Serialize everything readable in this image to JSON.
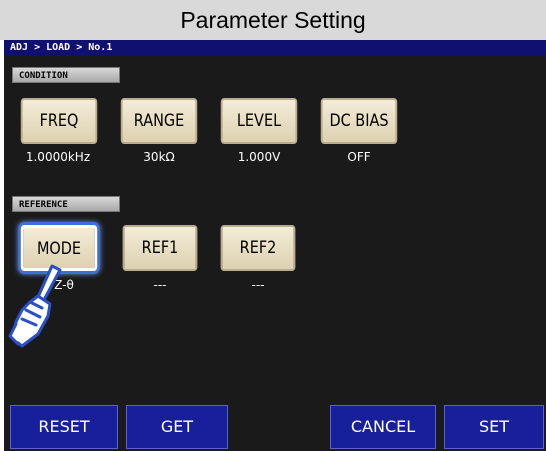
{
  "title": "Parameter Setting",
  "breadcrumb": "ADJ > LOAD > No.1",
  "condition": {
    "label": "CONDITION",
    "buttons": [
      {
        "label": "FREQ",
        "value": "1.0000kHz"
      },
      {
        "label": "RANGE",
        "value": "30kΩ"
      },
      {
        "label": "LEVEL",
        "value": "1.000V"
      },
      {
        "label": "DC BIAS",
        "value": "OFF"
      }
    ]
  },
  "reference": {
    "label": "REFERENCE",
    "buttons": [
      {
        "label": "MODE",
        "value": "Z-θ"
      },
      {
        "label": "REF1",
        "value": "---"
      },
      {
        "label": "REF2",
        "value": "---"
      }
    ]
  },
  "bottom": {
    "reset": "RESET",
    "get": "GET",
    "cancel": "CANCEL",
    "set": "SET"
  },
  "colors": {
    "screen_bg": "#1a1a1a",
    "breadcrumb_bg": "#101070",
    "button_face": "#ede4cc",
    "bottom_button": "#17209a",
    "selection_glow": "#3d6fd8"
  },
  "icons": {
    "pointer": "pointing-hand-icon"
  }
}
